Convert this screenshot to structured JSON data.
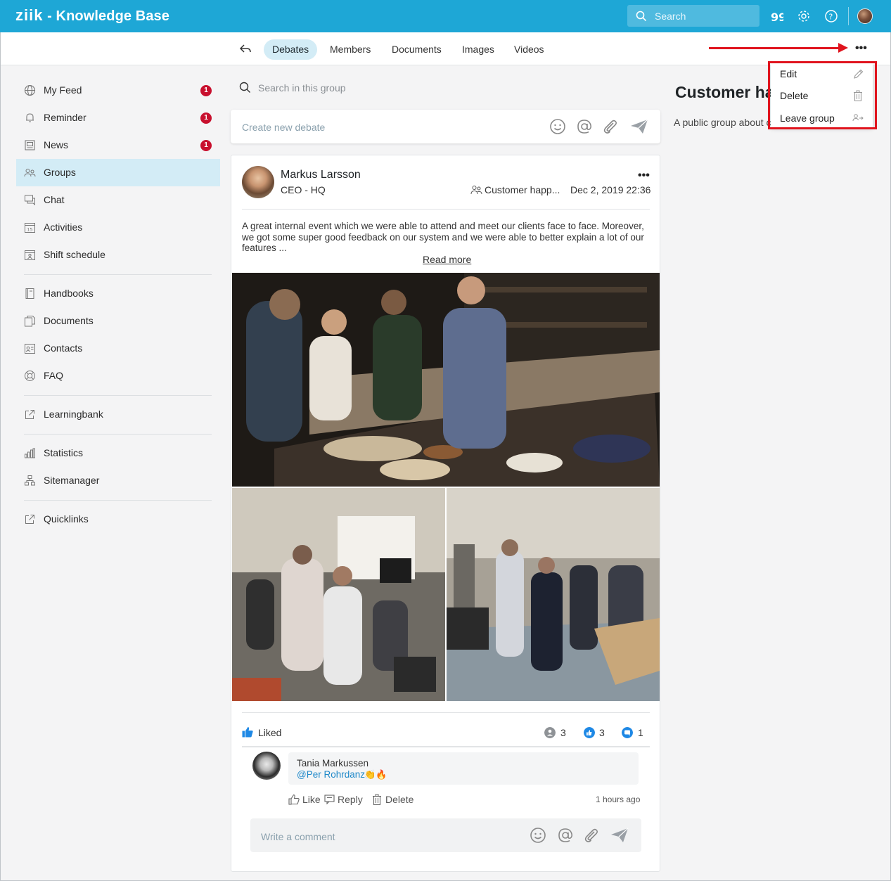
{
  "app": {
    "logo": "ziik",
    "title": "- Knowledge Base",
    "search_placeholder": "Search"
  },
  "tabs": [
    "Debates",
    "Members",
    "Documents",
    "Images",
    "Videos"
  ],
  "sidebar": {
    "items": [
      {
        "label": "My Feed",
        "badge": "1",
        "icon": "globe-icon"
      },
      {
        "label": "Reminder",
        "badge": "1",
        "icon": "bell-icon"
      },
      {
        "label": "News",
        "badge": "1",
        "icon": "news-icon"
      },
      {
        "label": "Groups",
        "badge": "",
        "icon": "groups-icon"
      },
      {
        "label": "Chat",
        "badge": "",
        "icon": "chat-icon"
      },
      {
        "label": "Activities",
        "badge": "",
        "icon": "calendar-icon"
      },
      {
        "label": "Shift schedule",
        "badge": "",
        "icon": "schedule-icon"
      },
      {
        "label": "Handbooks",
        "badge": "",
        "icon": "book-icon"
      },
      {
        "label": "Documents",
        "badge": "",
        "icon": "documents-icon"
      },
      {
        "label": "Contacts",
        "badge": "",
        "icon": "contacts-icon"
      },
      {
        "label": "FAQ",
        "badge": "",
        "icon": "lifebuoy-icon"
      },
      {
        "label": "Learningbank",
        "badge": "",
        "icon": "external-link-icon"
      },
      {
        "label": "Statistics",
        "badge": "",
        "icon": "bar-chart-icon"
      },
      {
        "label": "Sitemanager",
        "badge": "",
        "icon": "sitemap-icon"
      },
      {
        "label": "Quicklinks",
        "badge": "",
        "icon": "external-link-icon"
      }
    ]
  },
  "group_search_placeholder": "Search in this group",
  "new_debate_placeholder": "Create new debate",
  "post": {
    "author": "Markus Larsson",
    "role": "CEO - HQ",
    "group": "Customer happ...",
    "date": "Dec 2, 2019 22:36",
    "text": "A great internal event which we were able to attend and meet our clients face to face. Moreover, we got some super good feedback on our system and we were able to better explain a lot of our features ...",
    "read_more": "Read more",
    "liked_label": "Liked",
    "seen_count": "3",
    "likes_count": "3",
    "comments_count": "1"
  },
  "comment": {
    "author": "Tania Markussen",
    "mention": "@Per Rohrdanz",
    "emoji": "👏🔥",
    "like": "Like",
    "reply": "Reply",
    "delete": "Delete",
    "time": "1 hours ago"
  },
  "write_comment_placeholder": "Write a comment",
  "group_header": {
    "title": "Customer ha",
    "description": "A public group about c"
  },
  "context_menu": {
    "edit": "Edit",
    "delete": "Delete",
    "leave": "Leave group"
  },
  "colors": {
    "topbar": "#1ea7d6",
    "active_bg": "#d3ecf6",
    "badge": "#c8102e",
    "highlight": "#e0141e"
  }
}
